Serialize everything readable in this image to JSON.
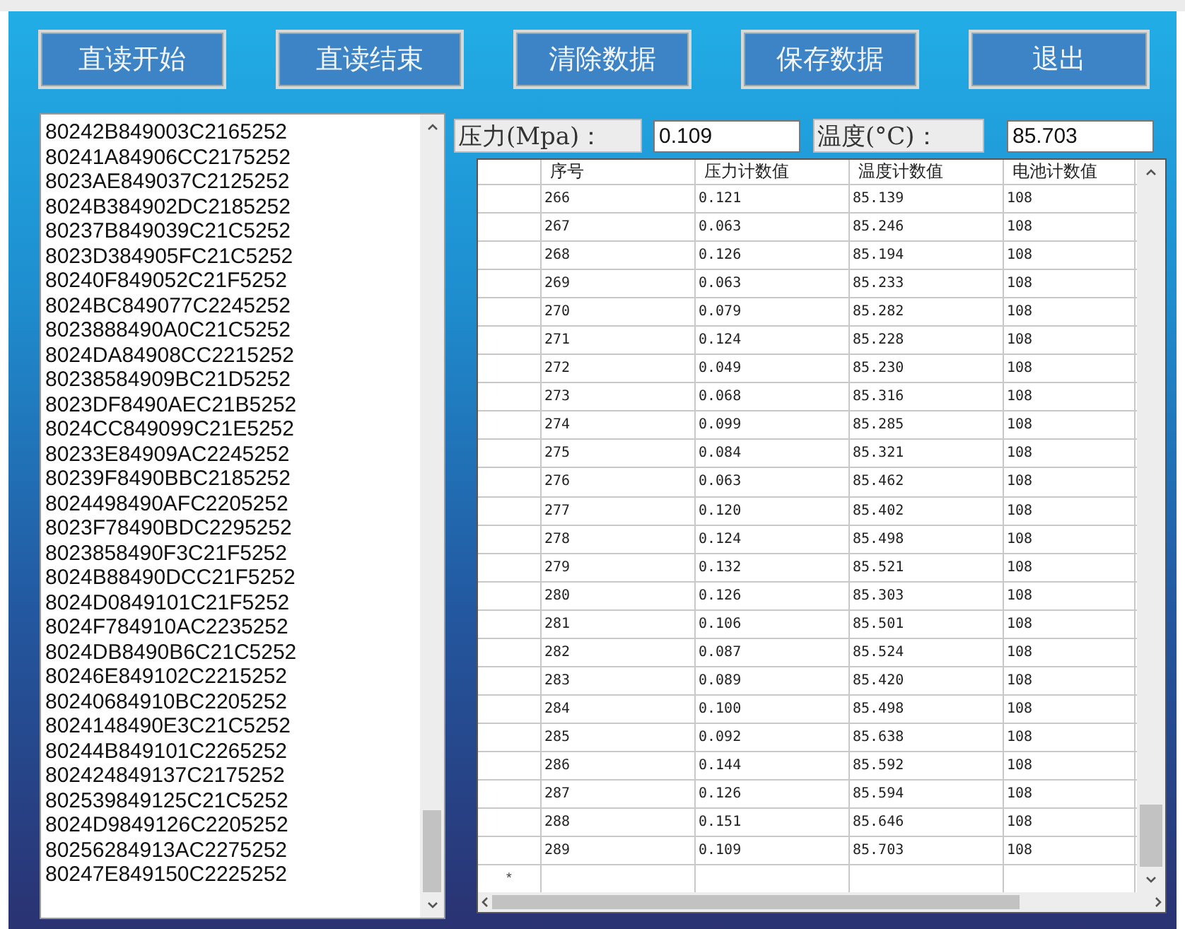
{
  "buttons": [
    "直读开始",
    "直读结束",
    "清除数据",
    "保存数据",
    "退出"
  ],
  "raw_list": [
    "80242B849003C2165252",
    "80241A84906CC2175252",
    "8023AE849037C2125252",
    "8024B384902DC2185252",
    "80237B849039C21C5252",
    "8023D384905FC21C5252",
    "80240F849052C21F5252",
    "8024BC849077C2245252",
    "8023888490A0C21C5252",
    "8024DA84908CC2215252",
    "80238584909BC21D5252",
    "8023DF8490AEC21B5252",
    "8024CC849099C21E5252",
    "80233E84909AC2245252",
    "80239F8490BBC2185252",
    "8024498490AFC2205252",
    "8023F78490BDC2295252",
    "8023858490F3C21F5252",
    "8024B88490DCC21F5252",
    "8024D0849101C21F5252",
    "8024F784910AC2235252",
    "8024DB8490B6C21C5252",
    "80246E849102C2215252",
    "80240684910BC2205252",
    "8024148490E3C21C5252",
    "80244B849101C2265252",
    "802424849137C2175252",
    "802539849125C21C5252",
    "8024D9849126C2205252",
    "80256284913AC2275252",
    "80247E849150C2225252"
  ],
  "pressure": {
    "label": "压力(Mpa)：",
    "value": "0.109"
  },
  "temperature": {
    "label": "温度(°C)：",
    "value": "85.703"
  },
  "table": {
    "columns": [
      "序号",
      "压力计数值",
      "温度计数值",
      "电池计数值"
    ],
    "rows": [
      [
        "266",
        "0.121",
        "85.139",
        "108"
      ],
      [
        "267",
        "0.063",
        "85.246",
        "108"
      ],
      [
        "268",
        "0.126",
        "85.194",
        "108"
      ],
      [
        "269",
        "0.063",
        "85.233",
        "108"
      ],
      [
        "270",
        "0.079",
        "85.282",
        "108"
      ],
      [
        "271",
        "0.124",
        "85.228",
        "108"
      ],
      [
        "272",
        "0.049",
        "85.230",
        "108"
      ],
      [
        "273",
        "0.068",
        "85.316",
        "108"
      ],
      [
        "274",
        "0.099",
        "85.285",
        "108"
      ],
      [
        "275",
        "0.084",
        "85.321",
        "108"
      ],
      [
        "276",
        "0.063",
        "85.462",
        "108"
      ],
      [
        "277",
        "0.120",
        "85.402",
        "108"
      ],
      [
        "278",
        "0.124",
        "85.498",
        "108"
      ],
      [
        "279",
        "0.132",
        "85.521",
        "108"
      ],
      [
        "280",
        "0.126",
        "85.303",
        "108"
      ],
      [
        "281",
        "0.106",
        "85.501",
        "108"
      ],
      [
        "282",
        "0.087",
        "85.524",
        "108"
      ],
      [
        "283",
        "0.089",
        "85.420",
        "108"
      ],
      [
        "284",
        "0.100",
        "85.498",
        "108"
      ],
      [
        "285",
        "0.092",
        "85.638",
        "108"
      ],
      [
        "286",
        "0.144",
        "85.592",
        "108"
      ],
      [
        "287",
        "0.126",
        "85.594",
        "108"
      ],
      [
        "288",
        "0.151",
        "85.646",
        "108"
      ],
      [
        "289",
        "0.109",
        "85.703",
        "108"
      ]
    ],
    "new_row_marker": "*"
  }
}
